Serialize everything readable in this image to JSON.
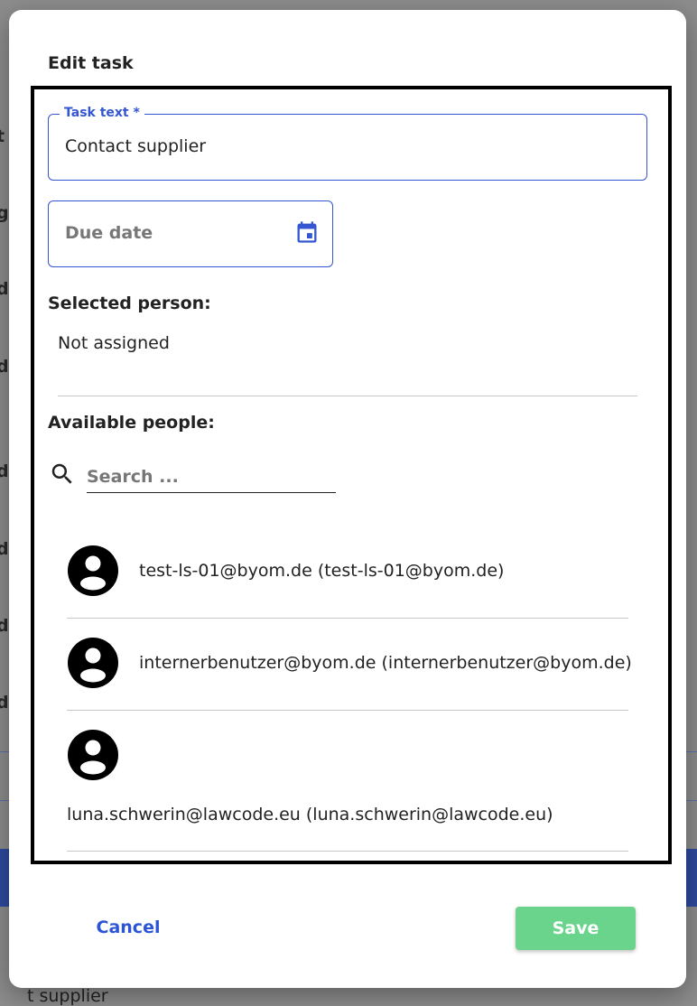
{
  "dialog": {
    "title": "Edit task",
    "task_text": {
      "label": "Task text *",
      "value": "Contact supplier"
    },
    "due_date": {
      "placeholder": "Due date"
    },
    "selected_person": {
      "label": "Selected person:",
      "value": "Not assigned"
    },
    "available_people": {
      "label": "Available people:",
      "search_placeholder": "Search ...",
      "people": [
        {
          "name": "test-ls-01@byom.de (test-ls-01@byom.de)"
        },
        {
          "name": "internerbenutzer@byom.de (internerbenutzer@byom.de)"
        },
        {
          "name": "luna.schwerin@lawcode.eu (luna.schwerin@lawcode.eu)"
        }
      ]
    },
    "actions": {
      "cancel_label": "Cancel",
      "save_label": "Save"
    }
  },
  "background": {
    "fragments": [
      "t",
      "g",
      "d",
      "d",
      "d",
      "d",
      "d",
      "d"
    ],
    "bottom_text": "t supplier"
  },
  "colors": {
    "primary": "#3456d1",
    "save": "#6ad48d",
    "link": "#2b55d6"
  },
  "icons": [
    "calendar-icon",
    "search-icon",
    "account-circle-icon"
  ]
}
